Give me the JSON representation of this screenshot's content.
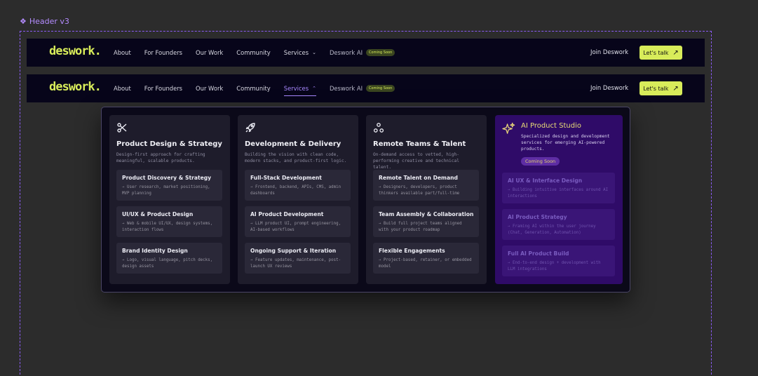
{
  "frame": {
    "label": "Header v3",
    "icon": "component-diamond-icon"
  },
  "header": {
    "logo": "deswork.",
    "nav": [
      {
        "label": "About"
      },
      {
        "label": "For Founders"
      },
      {
        "label": "Our Work"
      },
      {
        "label": "Community"
      },
      {
        "label": "Services"
      }
    ],
    "ai_label": "Deswork AI",
    "ai_badge": "Coming Soon",
    "join": "Join Deswork",
    "cta": "Let's talk",
    "accent": "#d8ec5a",
    "active_color": "#a888ff"
  },
  "mega": {
    "columns": [
      {
        "icon": "scissors-tools-icon",
        "title": "Product Design & Strategy",
        "desc": "Design-first approach for crafting meaningful, scalable products.",
        "items": [
          {
            "title": "Product Discovery & Strategy",
            "desc": "→ User research, market positioning, MVP planning"
          },
          {
            "title": "UI/UX & Product Design",
            "desc": "→ Web & mobile UI/UX, design systems, interaction flows"
          },
          {
            "title": "Brand Identity Design",
            "desc": "→ Logo, visual language, pitch decks, design assets"
          }
        ]
      },
      {
        "icon": "rocket-icon",
        "title": "Development & Delivery",
        "desc": "Building the vision with clean code, modern stacks, and product-first logic.",
        "items": [
          {
            "title": "Full-Stack Development",
            "desc": "→ Frontend, backend, APIs, CMS, admin dashboards"
          },
          {
            "title": "AI Product Development",
            "desc": "→ LLM product UI, prompt engineering, AI-based workflows"
          },
          {
            "title": "Ongoing Support & Iteration",
            "desc": "→ Feature updates, maintenance, post-launch UX reviews"
          }
        ]
      },
      {
        "icon": "team-nodes-icon",
        "title": "Remote Teams & Talent",
        "desc": "On-demand access to vetted, high-performing creative and technical talent.",
        "items": [
          {
            "title": "Remote Talent on Demand",
            "desc": "→ Designers, developers, product thinkers available part/full-time"
          },
          {
            "title": "Team Assembly & Collaboration",
            "desc": "→ Build full project teams aligned with your product roadmap"
          },
          {
            "title": "Flexible Engagements",
            "desc": "→ Project-based, retainer, or embedded model"
          }
        ]
      },
      {
        "icon": "sparkle-icon",
        "title": "AI Product Studio",
        "desc": "Specialized design and development services for emerging AI-powered products.",
        "badge": "Coming Soon",
        "items": [
          {
            "title": "AI UX & Interface Design",
            "desc": "→ Building intuitive interfaces around AI interactions"
          },
          {
            "title": "AI Product Strategy",
            "desc": "→ Framing AI within the user journey (Chat, Generation, Automation)"
          },
          {
            "title": "Full AI Product Build",
            "desc": "→ End-to-end design + development with LLM integrations"
          }
        ]
      }
    ]
  }
}
